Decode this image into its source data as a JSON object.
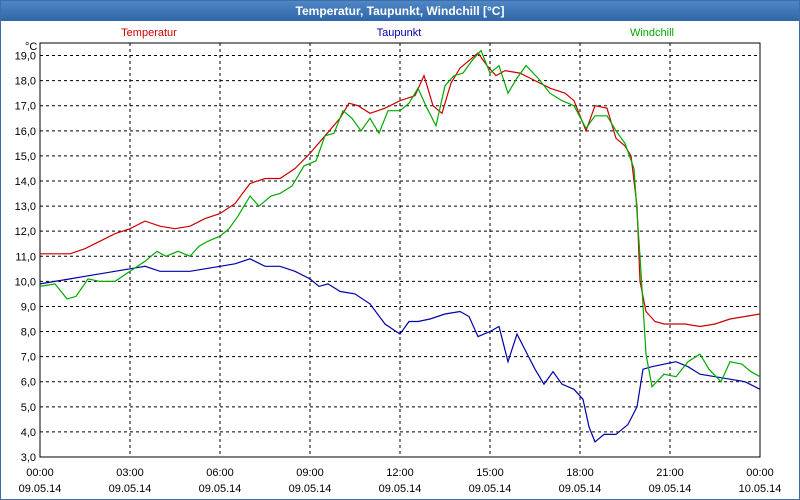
{
  "window": {
    "title": "Temperatur, Taupunkt, Windchill [°C]"
  },
  "chart_data": {
    "type": "line",
    "title": "Temperatur, Taupunkt, Windchill [°C]",
    "ylabel": "°C",
    "xlabel": "",
    "ylim": [
      3.0,
      19.5
    ],
    "xlim": [
      0,
      24
    ],
    "grid": true,
    "legend_placement": "top",
    "y_ticks": [
      "3,0",
      "4,0",
      "5,0",
      "6,0",
      "7,0",
      "8,0",
      "9,0",
      "10,0",
      "11,0",
      "12,0",
      "13,0",
      "14,0",
      "15,0",
      "16,0",
      "17,0",
      "18,0",
      "19,0"
    ],
    "x_ticks": [
      {
        "time": "00:00",
        "date": "09.05.14"
      },
      {
        "time": "03:00",
        "date": "09.05.14"
      },
      {
        "time": "06:00",
        "date": "09.05.14"
      },
      {
        "time": "09:00",
        "date": "09.05.14"
      },
      {
        "time": "12:00",
        "date": "09.05.14"
      },
      {
        "time": "15:00",
        "date": "09.05.14"
      },
      {
        "time": "18:00",
        "date": "09.05.14"
      },
      {
        "time": "21:00",
        "date": "09.05.14"
      },
      {
        "time": "00:00",
        "date": "10.05.14"
      }
    ],
    "series": [
      {
        "name": "Temperatur",
        "color": "#cc0000",
        "points": [
          [
            0,
            11.1
          ],
          [
            0.5,
            11.1
          ],
          [
            1,
            11.1
          ],
          [
            1.5,
            11.3
          ],
          [
            2,
            11.6
          ],
          [
            2.5,
            11.9
          ],
          [
            3,
            12.1
          ],
          [
            3.5,
            12.4
          ],
          [
            4,
            12.2
          ],
          [
            4.5,
            12.1
          ],
          [
            5,
            12.2
          ],
          [
            5.5,
            12.5
          ],
          [
            6,
            12.7
          ],
          [
            6.5,
            13.1
          ],
          [
            7,
            13.9
          ],
          [
            7.5,
            14.1
          ],
          [
            8,
            14.1
          ],
          [
            8.5,
            14.5
          ],
          [
            9,
            15.1
          ],
          [
            9.5,
            15.8
          ],
          [
            10,
            16.5
          ],
          [
            10.3,
            17.1
          ],
          [
            10.6,
            17.0
          ],
          [
            11,
            16.7
          ],
          [
            11.5,
            16.9
          ],
          [
            12,
            17.2
          ],
          [
            12.5,
            17.4
          ],
          [
            12.8,
            18.2
          ],
          [
            13.1,
            17.0
          ],
          [
            13.4,
            16.7
          ],
          [
            13.7,
            17.9
          ],
          [
            14,
            18.5
          ],
          [
            14.3,
            18.8
          ],
          [
            14.6,
            19.1
          ],
          [
            14.9,
            18.6
          ],
          [
            15.2,
            18.2
          ],
          [
            15.5,
            18.4
          ],
          [
            16,
            18.3
          ],
          [
            16.5,
            18.0
          ],
          [
            17,
            17.7
          ],
          [
            17.5,
            17.5
          ],
          [
            17.8,
            17.2
          ],
          [
            18.2,
            16.0
          ],
          [
            18.5,
            17.0
          ],
          [
            18.9,
            16.9
          ],
          [
            19.2,
            15.7
          ],
          [
            19.5,
            15.4
          ],
          [
            19.7,
            15.0
          ],
          [
            19.9,
            13.0
          ],
          [
            20.0,
            10.0
          ],
          [
            20.2,
            8.8
          ],
          [
            20.5,
            8.4
          ],
          [
            20.8,
            8.3
          ],
          [
            21.2,
            8.3
          ],
          [
            21.5,
            8.3
          ],
          [
            22,
            8.2
          ],
          [
            22.5,
            8.3
          ],
          [
            23,
            8.5
          ],
          [
            23.5,
            8.6
          ],
          [
            24,
            8.7
          ]
        ]
      },
      {
        "name": "Taupunkt",
        "color": "#0000aa",
        "points": [
          [
            0,
            9.9
          ],
          [
            0.5,
            10.0
          ],
          [
            1,
            10.1
          ],
          [
            1.5,
            10.2
          ],
          [
            2,
            10.3
          ],
          [
            2.5,
            10.4
          ],
          [
            3,
            10.5
          ],
          [
            3.5,
            10.6
          ],
          [
            4,
            10.4
          ],
          [
            4.5,
            10.4
          ],
          [
            5,
            10.4
          ],
          [
            5.5,
            10.5
          ],
          [
            6,
            10.6
          ],
          [
            6.5,
            10.7
          ],
          [
            7,
            10.9
          ],
          [
            7.5,
            10.6
          ],
          [
            8,
            10.6
          ],
          [
            8.5,
            10.4
          ],
          [
            9,
            10.1
          ],
          [
            9.3,
            9.8
          ],
          [
            9.6,
            9.9
          ],
          [
            10,
            9.6
          ],
          [
            10.5,
            9.5
          ],
          [
            11,
            9.1
          ],
          [
            11.5,
            8.3
          ],
          [
            12,
            7.9
          ],
          [
            12.3,
            8.4
          ],
          [
            12.6,
            8.4
          ],
          [
            13,
            8.5
          ],
          [
            13.5,
            8.7
          ],
          [
            14,
            8.8
          ],
          [
            14.3,
            8.6
          ],
          [
            14.6,
            7.8
          ],
          [
            15,
            8.0
          ],
          [
            15.3,
            8.2
          ],
          [
            15.6,
            6.8
          ],
          [
            15.9,
            7.9
          ],
          [
            16.2,
            7.2
          ],
          [
            16.5,
            6.5
          ],
          [
            16.8,
            5.9
          ],
          [
            17.1,
            6.4
          ],
          [
            17.4,
            5.9
          ],
          [
            17.8,
            5.7
          ],
          [
            18.1,
            5.3
          ],
          [
            18.3,
            4.2
          ],
          [
            18.5,
            3.6
          ],
          [
            18.8,
            3.9
          ],
          [
            19.2,
            3.9
          ],
          [
            19.6,
            4.3
          ],
          [
            19.9,
            5.0
          ],
          [
            20.1,
            6.5
          ],
          [
            20.4,
            6.6
          ],
          [
            20.8,
            6.7
          ],
          [
            21.2,
            6.8
          ],
          [
            21.6,
            6.6
          ],
          [
            22,
            6.3
          ],
          [
            22.5,
            6.2
          ],
          [
            23,
            6.1
          ],
          [
            23.5,
            6.0
          ],
          [
            24,
            5.7
          ]
        ]
      },
      {
        "name": "Windchill",
        "color": "#00aa00",
        "points": [
          [
            0,
            9.8
          ],
          [
            0.5,
            9.9
          ],
          [
            0.9,
            9.3
          ],
          [
            1.2,
            9.4
          ],
          [
            1.6,
            10.1
          ],
          [
            2,
            10.0
          ],
          [
            2.5,
            10.0
          ],
          [
            3,
            10.4
          ],
          [
            3.5,
            10.8
          ],
          [
            3.9,
            11.2
          ],
          [
            4.2,
            11.0
          ],
          [
            4.6,
            11.2
          ],
          [
            5,
            11.0
          ],
          [
            5.3,
            11.4
          ],
          [
            5.6,
            11.6
          ],
          [
            6,
            11.8
          ],
          [
            6.3,
            12.1
          ],
          [
            6.6,
            12.6
          ],
          [
            7,
            13.4
          ],
          [
            7.3,
            13.0
          ],
          [
            7.7,
            13.4
          ],
          [
            8,
            13.5
          ],
          [
            8.4,
            13.8
          ],
          [
            8.8,
            14.6
          ],
          [
            9.2,
            14.8
          ],
          [
            9.5,
            15.8
          ],
          [
            9.8,
            15.9
          ],
          [
            10.1,
            16.8
          ],
          [
            10.4,
            16.5
          ],
          [
            10.7,
            16.0
          ],
          [
            11,
            16.5
          ],
          [
            11.3,
            15.9
          ],
          [
            11.6,
            16.8
          ],
          [
            12,
            16.8
          ],
          [
            12.3,
            17.1
          ],
          [
            12.6,
            17.7
          ],
          [
            12.9,
            16.9
          ],
          [
            13.2,
            16.2
          ],
          [
            13.5,
            17.8
          ],
          [
            13.8,
            18.2
          ],
          [
            14.1,
            18.3
          ],
          [
            14.4,
            18.8
          ],
          [
            14.7,
            19.2
          ],
          [
            15.0,
            18.3
          ],
          [
            15.3,
            18.6
          ],
          [
            15.6,
            17.5
          ],
          [
            15.9,
            18.1
          ],
          [
            16.2,
            18.6
          ],
          [
            16.6,
            18.1
          ],
          [
            17,
            17.5
          ],
          [
            17.4,
            17.2
          ],
          [
            17.8,
            17.0
          ],
          [
            18.2,
            16.1
          ],
          [
            18.5,
            16.6
          ],
          [
            18.9,
            16.6
          ],
          [
            19.2,
            16.0
          ],
          [
            19.5,
            15.5
          ],
          [
            19.8,
            14.5
          ],
          [
            20.0,
            11.0
          ],
          [
            20.2,
            7.1
          ],
          [
            20.4,
            5.8
          ],
          [
            20.8,
            6.3
          ],
          [
            21.2,
            6.2
          ],
          [
            21.6,
            6.8
          ],
          [
            22,
            7.1
          ],
          [
            22.3,
            6.5
          ],
          [
            22.7,
            6.0
          ],
          [
            23,
            6.8
          ],
          [
            23.4,
            6.7
          ],
          [
            23.7,
            6.4
          ],
          [
            24,
            6.2
          ]
        ]
      }
    ]
  }
}
